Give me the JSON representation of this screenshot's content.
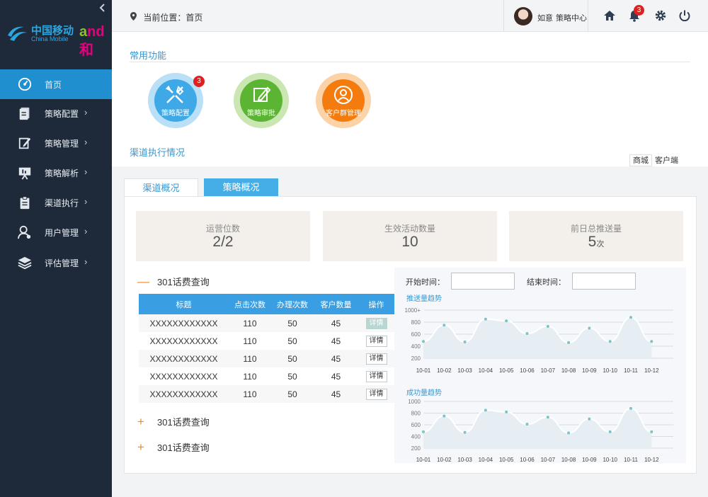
{
  "sidebar": {
    "logo": {
      "cn": "中国移动",
      "en": "China Mobile",
      "brand": "和"
    },
    "collapse_icon": "chevron-left",
    "items": [
      {
        "label": "首页",
        "icon": "dashboard-icon",
        "active": true,
        "arrow": ""
      },
      {
        "label": "策略配置",
        "icon": "document-icon",
        "arrow": "›"
      },
      {
        "label": "策略管理",
        "icon": "edit-icon",
        "arrow": "›"
      },
      {
        "label": "策略解析",
        "icon": "presentation-icon",
        "arrow": "›"
      },
      {
        "label": "渠道执行",
        "icon": "clipboard-icon",
        "arrow": "›"
      },
      {
        "label": "用户管理",
        "icon": "user-gear-icon",
        "arrow": "›"
      },
      {
        "label": "评估管理",
        "icon": "layers-icon",
        "arrow": "›"
      }
    ]
  },
  "topbar": {
    "breadcrumb": "当前位置：首页",
    "user_name": "如意",
    "user_center": "策略中心",
    "notifications": "3",
    "icons": [
      "home-icon",
      "bell-icon",
      "gear-icon",
      "power-icon"
    ]
  },
  "main": {
    "common_title": "常用功能",
    "quick_functions": [
      {
        "label": "策略配置",
        "color": "#3fa9e7",
        "ring": "#b9e0f6",
        "badge": "3"
      },
      {
        "label": "策略审批",
        "color": "#5cb433",
        "ring": "#c9e6b3"
      },
      {
        "label": "客户群管理",
        "color": "#f47c0e",
        "ring": "#fbd3a6"
      }
    ],
    "channel_title": "渠道执行情况",
    "segments": [
      "商城",
      "客户端"
    ],
    "tabs": [
      "渠道概况",
      "策略概况"
    ],
    "kpis": [
      {
        "title": "运营位数",
        "value": "2/2",
        "unit": ""
      },
      {
        "title": "生效活动数量",
        "value": "10",
        "unit": ""
      },
      {
        "title": "前日总推送量",
        "value": "5",
        "unit": "次"
      }
    ],
    "groups": [
      "301话费查询",
      "301话费查询",
      "301话费查询"
    ],
    "table": {
      "headers": [
        "标题",
        "点击次数",
        "办理次数",
        "客户数量",
        "操作"
      ],
      "rows": [
        [
          "XXXXXXXXXXXX",
          "110",
          "50",
          "45",
          "详情"
        ],
        [
          "XXXXXXXXXXXX",
          "110",
          "50",
          "45",
          "详情"
        ],
        [
          "XXXXXXXXXXXX",
          "110",
          "50",
          "45",
          "详情"
        ],
        [
          "XXXXXXXXXXXX",
          "110",
          "50",
          "45",
          "详情"
        ],
        [
          "XXXXXXXXXXXX",
          "110",
          "50",
          "45",
          "详情"
        ]
      ]
    },
    "filter": {
      "start_label": "开始时间：",
      "end_label": "结束时间：",
      "start_value": "",
      "end_value": ""
    }
  },
  "chart_data": [
    {
      "type": "area",
      "title": "推送量趋势",
      "categories": [
        "10-01",
        "10-02",
        "10-03",
        "10-04",
        "10-05",
        "10-06",
        "10-07",
        "10-08",
        "10-09",
        "10-10",
        "10-11",
        "10-12"
      ],
      "values": [
        480,
        750,
        470,
        850,
        820,
        610,
        730,
        460,
        700,
        480,
        880,
        480
      ],
      "y_ticks": [
        "1000+",
        "800",
        "600",
        "400",
        "200"
      ],
      "ylim": [
        200,
        1000
      ],
      "color": "#7ec2c4"
    },
    {
      "type": "area",
      "title": "成功量趋势",
      "categories": [
        "10-01",
        "10-02",
        "10-03",
        "10-04",
        "10-05",
        "10-06",
        "10-07",
        "10-08",
        "10-09",
        "10-10",
        "10-11",
        "10-12"
      ],
      "values": [
        480,
        750,
        470,
        850,
        820,
        610,
        730,
        460,
        700,
        480,
        880,
        480
      ],
      "y_ticks": [
        "1000",
        "800",
        "600",
        "400",
        "200"
      ],
      "ylim": [
        200,
        1000
      ],
      "color": "#7ec2c4"
    }
  ]
}
